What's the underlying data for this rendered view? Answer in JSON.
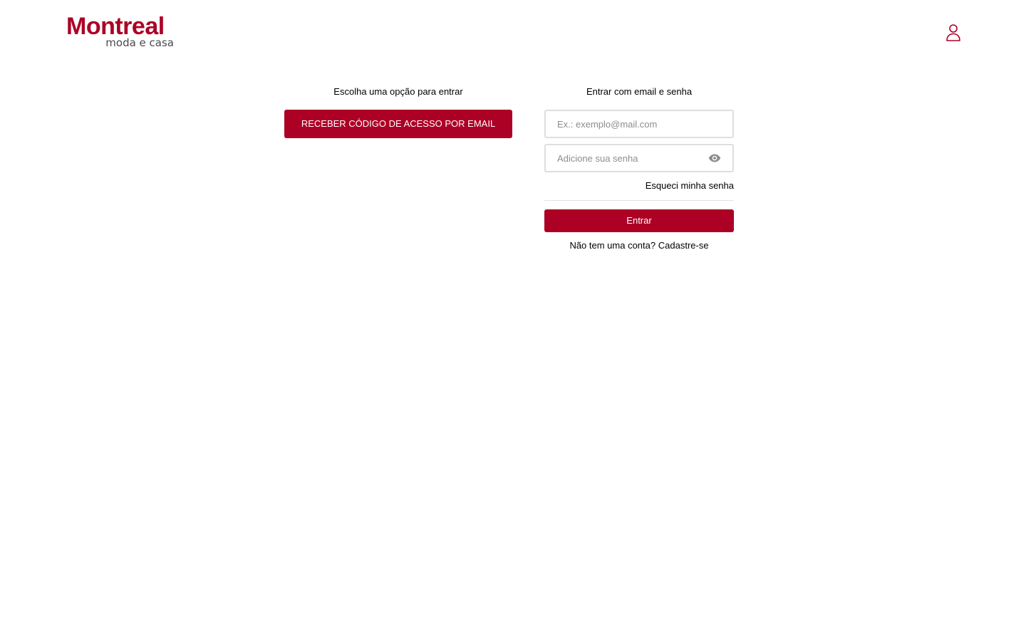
{
  "colors": {
    "brand": "#ac0025",
    "logo_sub": "#4a4a4a"
  },
  "header": {
    "logo": {
      "main": "Montreal",
      "sub": "moda e casa"
    },
    "user_icon": "user-icon"
  },
  "code_login": {
    "title": "Escolha uma opção para entrar",
    "button_label": "RECEBER CÓDIGO DE ACESSO POR EMAIL"
  },
  "email_login": {
    "title": "Entrar com email e senha",
    "email_placeholder": "Ex.: exemplo@mail.com",
    "password_placeholder": "Adicione sua senha",
    "password_toggle_icon": "eye-icon",
    "forgot_label": "Esqueci minha senha",
    "submit_label": "Entrar",
    "signup_prompt": "Não tem uma conta?",
    "signup_link": "Cadastre-se"
  }
}
